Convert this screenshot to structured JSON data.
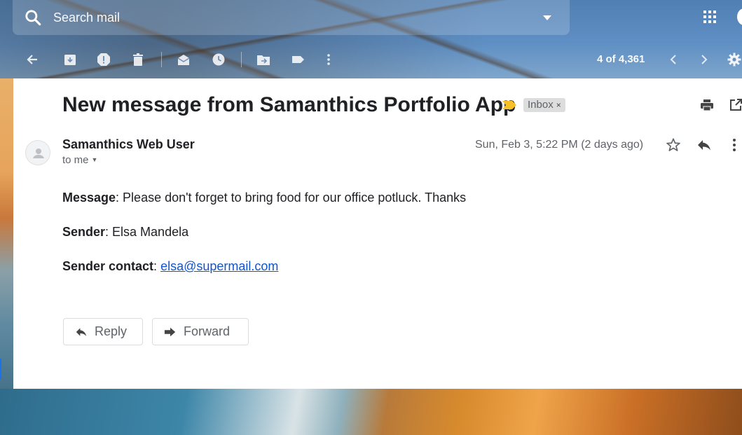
{
  "search": {
    "placeholder": "Search mail"
  },
  "toolbar": {
    "icons": [
      "back-arrow-icon",
      "archive-icon",
      "report-spam-icon",
      "delete-icon",
      "mark-unread-icon",
      "snooze-icon",
      "move-to-icon",
      "labels-icon",
      "more-vert-icon"
    ],
    "pager_text": "4 of 4,361"
  },
  "message": {
    "subject": "New message from Samanthics Portfolio App",
    "label": "Inbox",
    "label_close": "×",
    "sender_name": "Samanthics Web User",
    "recipient": "to me",
    "date": "Sun, Feb 3, 5:22 PM (2 days ago)",
    "body": {
      "message_label": "Message",
      "message_text": ": Please don't forget to bring food for our office potluck. Thanks",
      "sender_label": "Sender",
      "sender_text": ": Elsa Mandela",
      "contact_label": "Sender contact",
      "contact_sep": ": ",
      "contact_email": "elsa@supermail.com"
    }
  },
  "actions": {
    "reply_label": "Reply",
    "forward_label": "Forward"
  },
  "colors": {
    "link": "#1155cc",
    "importance_marker": "#f6c026",
    "accent": "#1a73e8"
  }
}
